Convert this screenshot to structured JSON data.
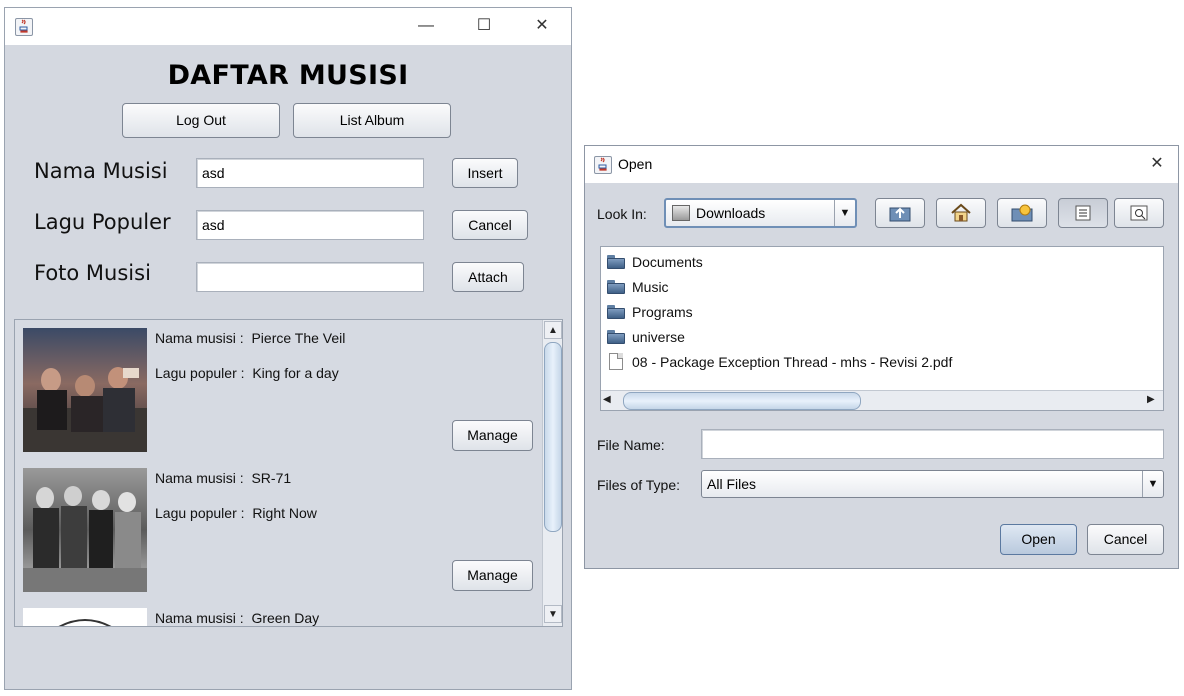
{
  "main_window": {
    "title": "DAFTAR MUSISI",
    "window_controls": {
      "minimize": "—",
      "maximize": "☐",
      "close": "✕"
    },
    "buttons": {
      "logout": "Log Out",
      "list_album": "List Album"
    },
    "form": {
      "nama_label": "Nama Musisi",
      "nama_value": "asd",
      "lagu_label": "Lagu Populer",
      "lagu_value": "asd",
      "foto_label": "Foto Musisi",
      "foto_value": "",
      "insert": "Insert",
      "cancel": "Cancel",
      "attach": "Attach"
    },
    "musicians": [
      {
        "nama_label": "Nama musisi :",
        "nama": "Pierce The Veil",
        "lagu_label": "Lagu populer :",
        "lagu": "King for a day",
        "manage": "Manage"
      },
      {
        "nama_label": "Nama musisi :",
        "nama": "SR-71",
        "lagu_label": "Lagu populer :",
        "lagu": "Right Now",
        "manage": "Manage"
      },
      {
        "nama_label": "Nama musisi :",
        "nama": "Green Day"
      }
    ],
    "scrollbar": {
      "up": "▲",
      "down": "▼"
    }
  },
  "open_dialog": {
    "title": "Open",
    "close": "✕",
    "look_in_label": "Look In:",
    "look_in_value": "Downloads",
    "toolbar_icons": [
      "up-folder-icon",
      "home-icon",
      "new-folder-icon",
      "list-view-icon",
      "details-view-icon"
    ],
    "files": [
      {
        "name": "Documents",
        "type": "folder"
      },
      {
        "name": "Music",
        "type": "folder"
      },
      {
        "name": "Programs",
        "type": "folder"
      },
      {
        "name": "universe",
        "type": "folder"
      },
      {
        "name": "08 - Package Exception Thread - mhs - Revisi 2.pdf",
        "type": "file"
      }
    ],
    "scroll_left": "◀",
    "scroll_right": "▶",
    "file_name_label": "File Name:",
    "file_name_value": "",
    "file_type_label": "Files of Type:",
    "file_type_value": "All Files",
    "open_button": "Open",
    "cancel_button": "Cancel",
    "dropdown_arrow": "▼"
  }
}
